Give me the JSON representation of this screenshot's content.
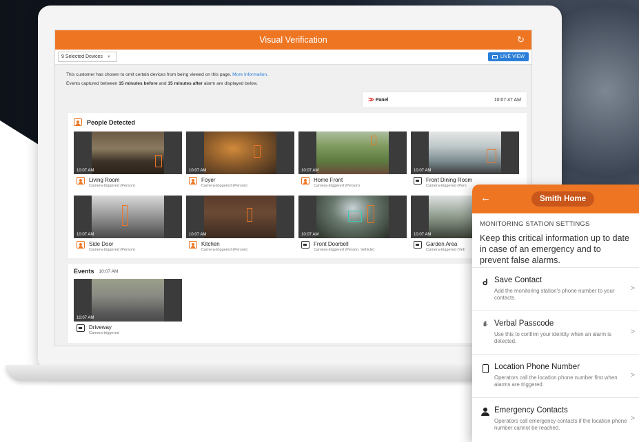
{
  "app": {
    "title": "Visual Verification"
  },
  "toolbar": {
    "device_select": "9 Selected Devices",
    "live_view": "LIVE VIEW"
  },
  "notice": {
    "line1": "This customer has chosen to omit certain devices from being viewed on this page.",
    "link": "More Information.",
    "line2_a": "Events captured between ",
    "before": "15 minutes before",
    "and": " and ",
    "after": "15 minutes after",
    "line2_b": " alarm are displayed below."
  },
  "panel": {
    "label": "Panel",
    "time": "10:07:47 AM"
  },
  "people": {
    "title": "People Detected",
    "tiles": [
      {
        "name": "Living Room",
        "sub": "Camera-triggered (Person)",
        "time": "10:07 AM",
        "icon": "person"
      },
      {
        "name": "Foyer",
        "sub": "Camera-triggered (Person)",
        "time": "10:07 AM",
        "icon": "person"
      },
      {
        "name": "Home Front",
        "sub": "Camera-triggered (Person)",
        "time": "10:07 AM",
        "icon": "person"
      },
      {
        "name": "Front Dining Room",
        "sub": "Camera-triggered (Pers",
        "time": "10:07 AM",
        "icon": "camera"
      },
      {
        "name": "Side Door",
        "sub": "Camera-triggered (Person)",
        "time": "10:07 AM",
        "icon": "person"
      },
      {
        "name": "Kitchen",
        "sub": "Camera-triggered (Person)",
        "time": "10:07 AM",
        "icon": "person"
      },
      {
        "name": "Front Doorbell",
        "sub": "Camera-triggered (Person, Vehicle)",
        "time": "10:07 AM",
        "icon": "camera"
      },
      {
        "name": "Garden Area",
        "sub": "Camera-triggered (Veh",
        "time": "10:07 AM",
        "icon": "camera"
      }
    ]
  },
  "events": {
    "title": "Events",
    "time": "10:07 AM",
    "tile": {
      "name": "Driveway",
      "sub": "Camera-triggered",
      "time": "10:07 AM"
    }
  },
  "phone": {
    "back": "←",
    "title": "Smith Home",
    "settings_label": "MONITORING STATION SETTINGS",
    "description": "Keep this critical information up to date in case of an emergency and to prevent false alarms.",
    "items": [
      {
        "title": "Save Contact",
        "sub": "Add the monitoring station's phone number to your contacts.",
        "icon": "contact-icon"
      },
      {
        "title": "Verbal Passcode",
        "sub": "Use this to confirm your identity when an alarm is detected.",
        "icon": "waveform-icon"
      },
      {
        "title": "Location Phone Number",
        "sub": "Operators call the location phone number first when alarms are triggered.",
        "icon": "phone-icon"
      },
      {
        "title": "Emergency Contacts",
        "sub": "Operators call emergency contacts if the location phone number cannot be reached.",
        "icon": "person-icon"
      }
    ]
  },
  "colors": {
    "brand": "#ee7623",
    "link": "#2b7fd8",
    "panel_red": "#e0312e"
  }
}
